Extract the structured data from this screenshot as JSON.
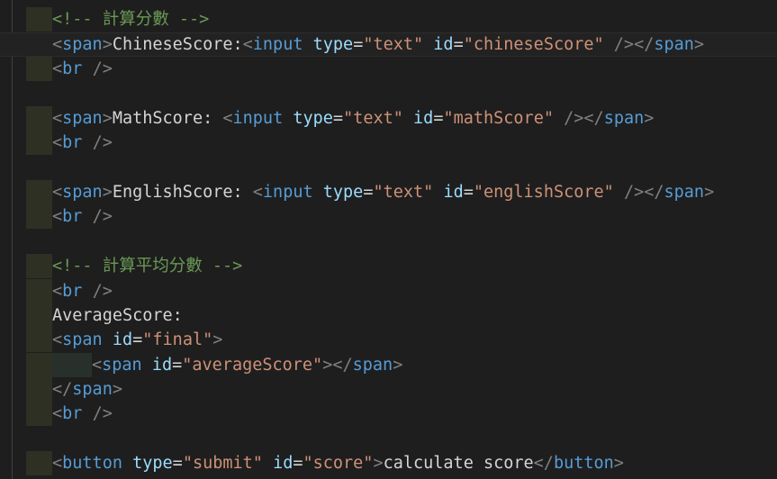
{
  "colors": {
    "background": "#1e1e1e",
    "comment": "#6a9955",
    "bracket": "#808080",
    "tag": "#569cd6",
    "attribute": "#9cdcfe",
    "string": "#ce9178",
    "text": "#d4d4d4"
  },
  "editor": {
    "lines": [
      [
        {
          "t": "cm",
          "v": "<!-- 計算分數 -->"
        }
      ],
      [
        {
          "t": "bk",
          "v": "<"
        },
        {
          "t": "tg",
          "v": "span"
        },
        {
          "t": "bk",
          "v": ">"
        },
        {
          "t": "tx",
          "v": "ChineseScore:"
        },
        {
          "t": "bk",
          "v": "<"
        },
        {
          "t": "tg",
          "v": "input"
        },
        {
          "t": "tx",
          "v": " "
        },
        {
          "t": "at",
          "v": "type"
        },
        {
          "t": "tx",
          "v": "="
        },
        {
          "t": "st",
          "v": "\"text\""
        },
        {
          "t": "tx",
          "v": " "
        },
        {
          "t": "at",
          "v": "id"
        },
        {
          "t": "tx",
          "v": "="
        },
        {
          "t": "st",
          "v": "\"chineseScore\""
        },
        {
          "t": "tx",
          "v": " "
        },
        {
          "t": "bk",
          "v": "/></"
        },
        {
          "t": "tg",
          "v": "span"
        },
        {
          "t": "bk",
          "v": ">"
        }
      ],
      [
        {
          "t": "bk",
          "v": "<"
        },
        {
          "t": "tg",
          "v": "br"
        },
        {
          "t": "tx",
          "v": " "
        },
        {
          "t": "bk",
          "v": "/>"
        }
      ],
      [],
      [
        {
          "t": "bk",
          "v": "<"
        },
        {
          "t": "tg",
          "v": "span"
        },
        {
          "t": "bk",
          "v": ">"
        },
        {
          "t": "tx",
          "v": "MathScore: "
        },
        {
          "t": "bk",
          "v": "<"
        },
        {
          "t": "tg",
          "v": "input"
        },
        {
          "t": "tx",
          "v": " "
        },
        {
          "t": "at",
          "v": "type"
        },
        {
          "t": "tx",
          "v": "="
        },
        {
          "t": "st",
          "v": "\"text\""
        },
        {
          "t": "tx",
          "v": " "
        },
        {
          "t": "at",
          "v": "id"
        },
        {
          "t": "tx",
          "v": "="
        },
        {
          "t": "st",
          "v": "\"mathScore\""
        },
        {
          "t": "tx",
          "v": " "
        },
        {
          "t": "bk",
          "v": "/></"
        },
        {
          "t": "tg",
          "v": "span"
        },
        {
          "t": "bk",
          "v": ">"
        }
      ],
      [
        {
          "t": "bk",
          "v": "<"
        },
        {
          "t": "tg",
          "v": "br"
        },
        {
          "t": "tx",
          "v": " "
        },
        {
          "t": "bk",
          "v": "/>"
        }
      ],
      [],
      [
        {
          "t": "bk",
          "v": "<"
        },
        {
          "t": "tg",
          "v": "span"
        },
        {
          "t": "bk",
          "v": ">"
        },
        {
          "t": "tx",
          "v": "EnglishScore: "
        },
        {
          "t": "bk",
          "v": "<"
        },
        {
          "t": "tg",
          "v": "input"
        },
        {
          "t": "tx",
          "v": " "
        },
        {
          "t": "at",
          "v": "type"
        },
        {
          "t": "tx",
          "v": "="
        },
        {
          "t": "st",
          "v": "\"text\""
        },
        {
          "t": "tx",
          "v": " "
        },
        {
          "t": "at",
          "v": "id"
        },
        {
          "t": "tx",
          "v": "="
        },
        {
          "t": "st",
          "v": "\"englishScore\""
        },
        {
          "t": "tx",
          "v": " "
        },
        {
          "t": "bk",
          "v": "/></"
        },
        {
          "t": "tg",
          "v": "span"
        },
        {
          "t": "bk",
          "v": ">"
        }
      ],
      [
        {
          "t": "bk",
          "v": "<"
        },
        {
          "t": "tg",
          "v": "br"
        },
        {
          "t": "tx",
          "v": " "
        },
        {
          "t": "bk",
          "v": "/>"
        }
      ],
      [],
      [
        {
          "t": "cm",
          "v": "<!-- 計算平均分數 -->"
        }
      ],
      [
        {
          "t": "bk",
          "v": "<"
        },
        {
          "t": "tg",
          "v": "br"
        },
        {
          "t": "tx",
          "v": " "
        },
        {
          "t": "bk",
          "v": "/>"
        }
      ],
      [
        {
          "t": "tx",
          "v": "AverageScore:"
        }
      ],
      [
        {
          "t": "bk",
          "v": "<"
        },
        {
          "t": "tg",
          "v": "span"
        },
        {
          "t": "tx",
          "v": " "
        },
        {
          "t": "at",
          "v": "id"
        },
        {
          "t": "tx",
          "v": "="
        },
        {
          "t": "st",
          "v": "\"final\""
        },
        {
          "t": "bk",
          "v": ">"
        }
      ],
      [
        {
          "t": "bk",
          "v": "<"
        },
        {
          "t": "tg",
          "v": "span"
        },
        {
          "t": "tx",
          "v": " "
        },
        {
          "t": "at",
          "v": "id"
        },
        {
          "t": "tx",
          "v": "="
        },
        {
          "t": "st",
          "v": "\"averageScore\""
        },
        {
          "t": "bk",
          "v": "></"
        },
        {
          "t": "tg",
          "v": "span"
        },
        {
          "t": "bk",
          "v": ">"
        }
      ],
      [
        {
          "t": "bk",
          "v": "</"
        },
        {
          "t": "tg",
          "v": "span"
        },
        {
          "t": "bk",
          "v": ">"
        }
      ],
      [
        {
          "t": "bk",
          "v": "<"
        },
        {
          "t": "tg",
          "v": "br"
        },
        {
          "t": "tx",
          "v": " "
        },
        {
          "t": "bk",
          "v": "/>"
        }
      ],
      [],
      [
        {
          "t": "bk",
          "v": "<"
        },
        {
          "t": "tg",
          "v": "button"
        },
        {
          "t": "tx",
          "v": " "
        },
        {
          "t": "at",
          "v": "type"
        },
        {
          "t": "tx",
          "v": "="
        },
        {
          "t": "st",
          "v": "\"submit\""
        },
        {
          "t": "tx",
          "v": " "
        },
        {
          "t": "at",
          "v": "id"
        },
        {
          "t": "tx",
          "v": "="
        },
        {
          "t": "st",
          "v": "\"score\""
        },
        {
          "t": "bk",
          "v": ">"
        },
        {
          "t": "tx",
          "v": "calculate score"
        },
        {
          "t": "bk",
          "v": "</"
        },
        {
          "t": "tg",
          "v": "button"
        },
        {
          "t": "bk",
          "v": ">"
        }
      ]
    ]
  }
}
